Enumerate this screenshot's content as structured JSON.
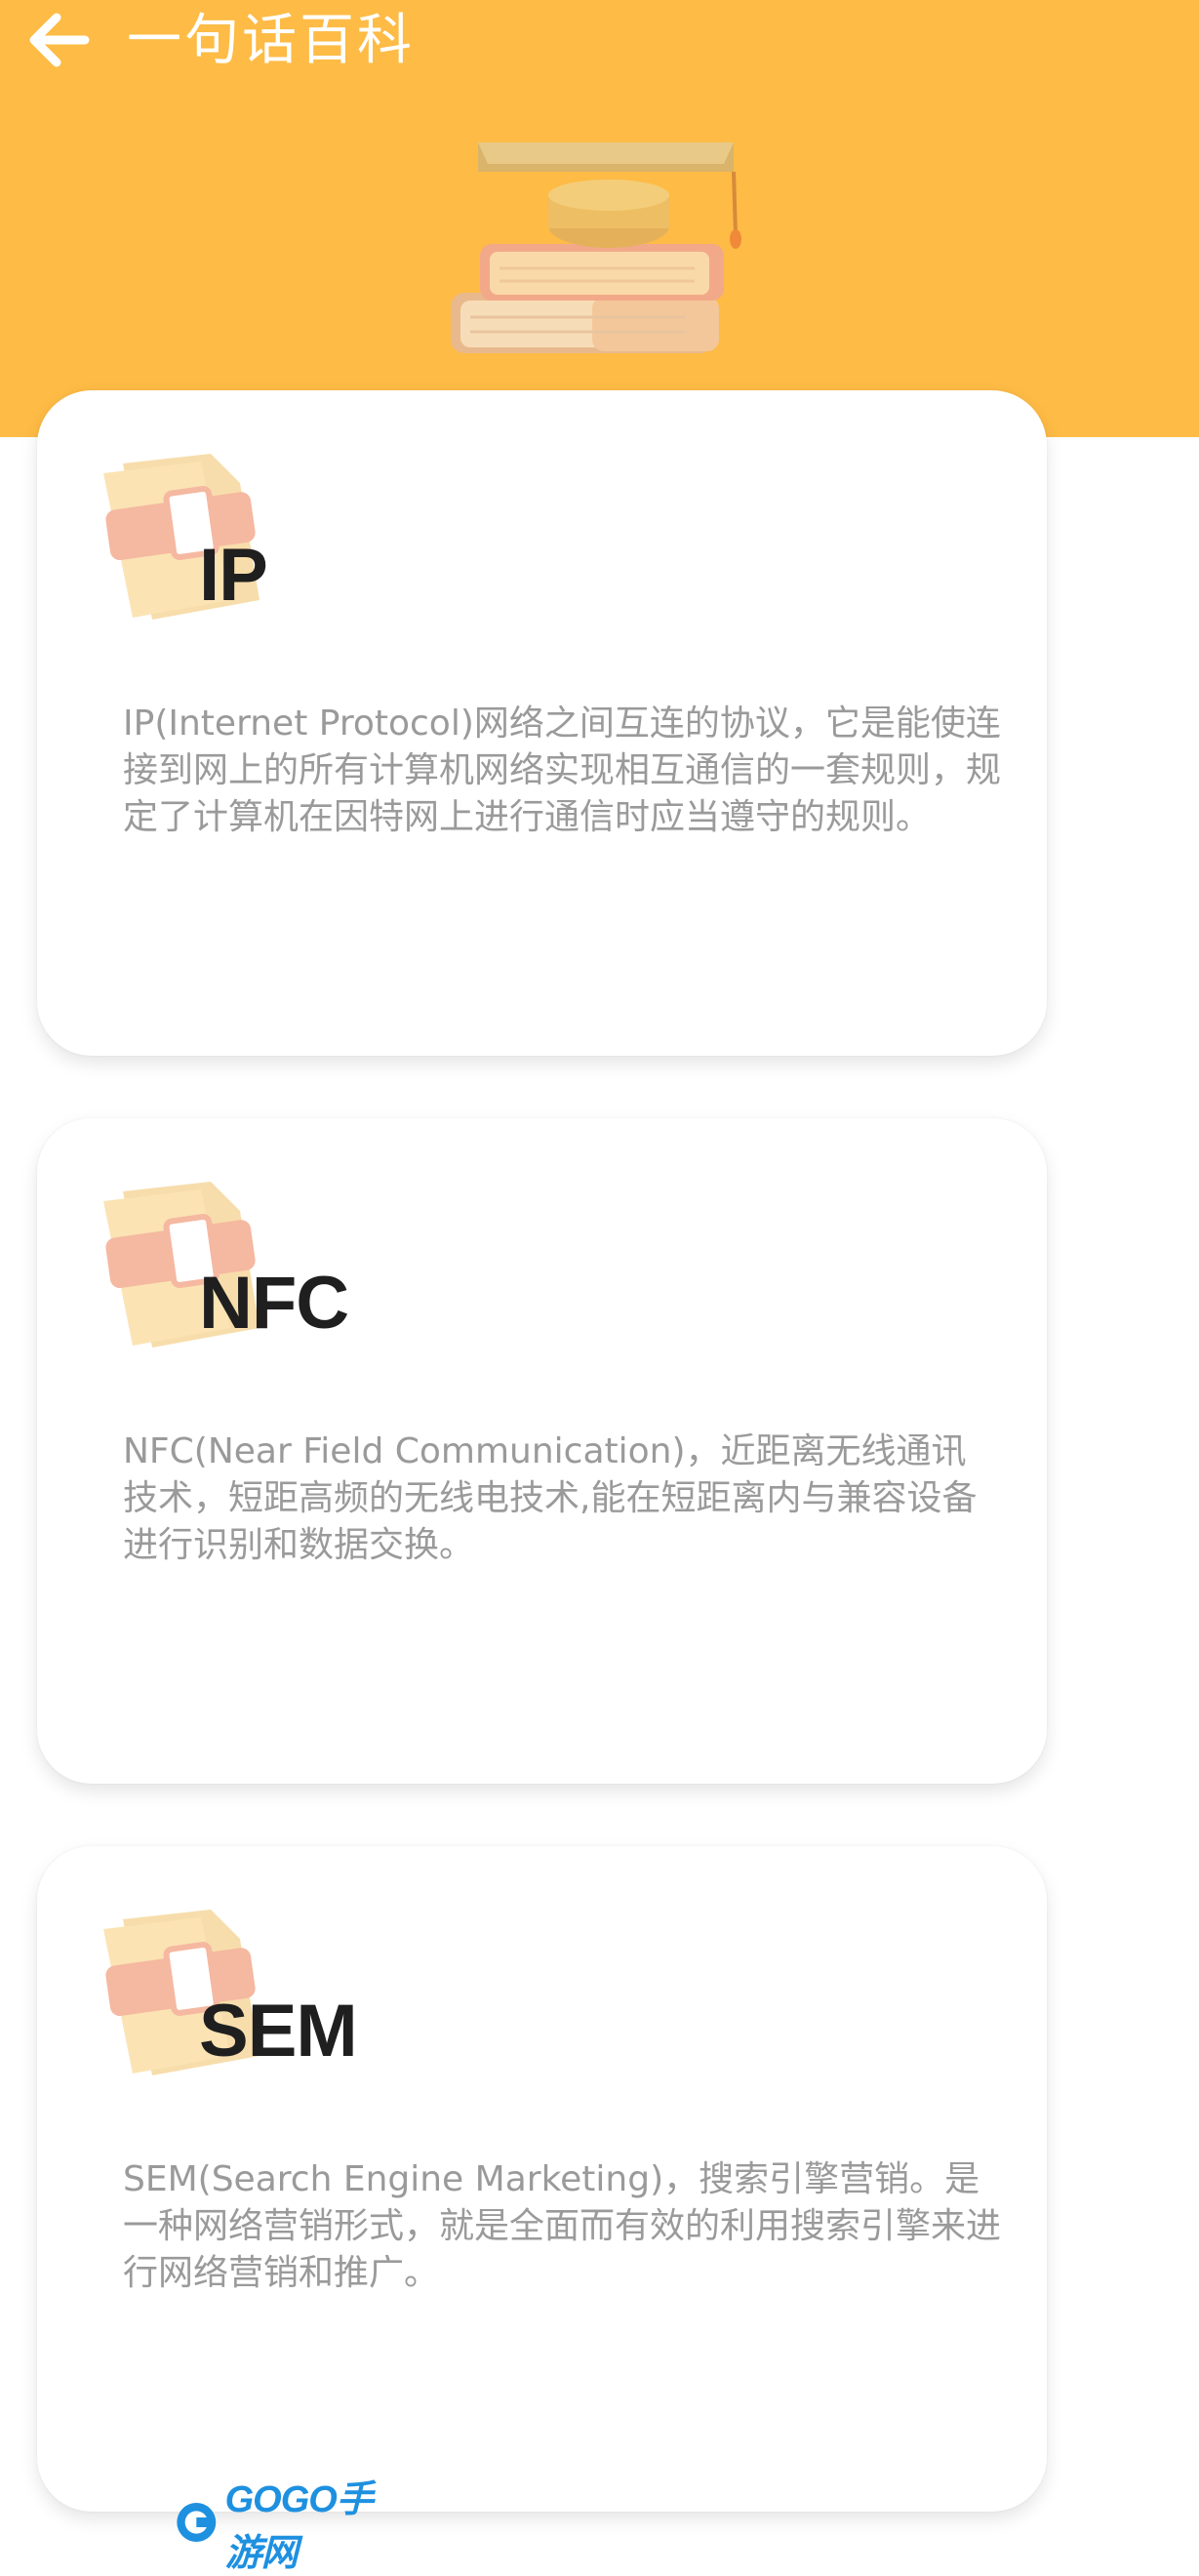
{
  "app_bar": {
    "title": "一句话百科",
    "back_icon": "arrow-left-icon",
    "background": "#FEBB45"
  },
  "hero": {
    "icon": "graduation-cap-books-icon"
  },
  "cards": [
    {
      "icon": "folder-book-icon",
      "title": "IP",
      "description": "IP(Internet Protocol)网络之间互连的协议，它是能使连接到网上的所有计算机网络实现相互通信的一套规则，规定了计算机在因特网上进行通信时应当遵守的规则。"
    },
    {
      "icon": "folder-book-icon",
      "title": "NFC",
      "description": "NFC(Near Field Communication)，近距离无线通讯技术，短距高频的无线电技术,能在短距离内与兼容设备进行识别和数据交换。"
    },
    {
      "icon": "folder-book-icon",
      "title": "SEM",
      "description": "SEM(Search Engine Marketing)，搜索引擎营销。是一种网络营销形式，就是全面而有效的利用搜索引擎来进行网络营销和推广。"
    }
  ],
  "watermark": {
    "text": "GOGO手游网",
    "icon": "gogo-logo-icon"
  }
}
